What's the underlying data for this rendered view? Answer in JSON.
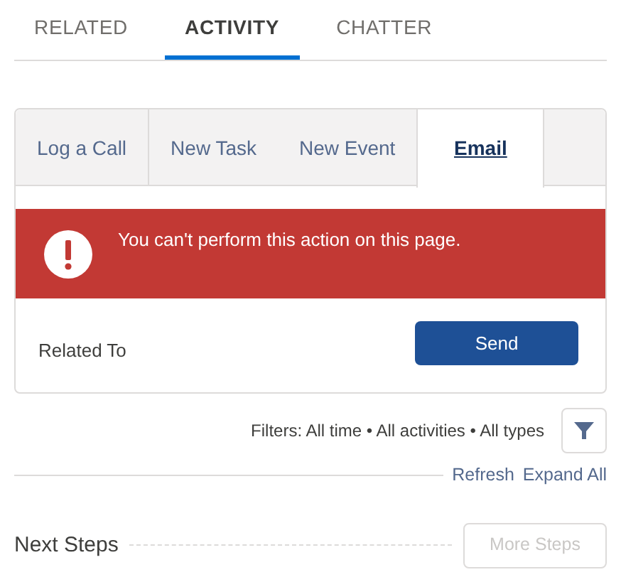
{
  "tabs": [
    {
      "label": "RELATED",
      "selected": false
    },
    {
      "label": "ACTIVITY",
      "selected": true
    },
    {
      "label": "CHATTER",
      "selected": false
    }
  ],
  "composer": {
    "tabs": [
      {
        "label": "Log a Call",
        "selected": false
      },
      {
        "label": "New Task",
        "selected": false
      },
      {
        "label": "New Event",
        "selected": false
      },
      {
        "label": "Email",
        "selected": true
      }
    ],
    "error": "You can't perform this action on this page.",
    "related_to_label": "Related To",
    "send_button": "Send"
  },
  "filters": {
    "text": "Filters: All time • All activities • All types"
  },
  "links": [
    "Refresh",
    "Expand All"
  ],
  "next_steps": {
    "title": "Next Steps",
    "button": "More Steps",
    "disabled": true
  }
}
